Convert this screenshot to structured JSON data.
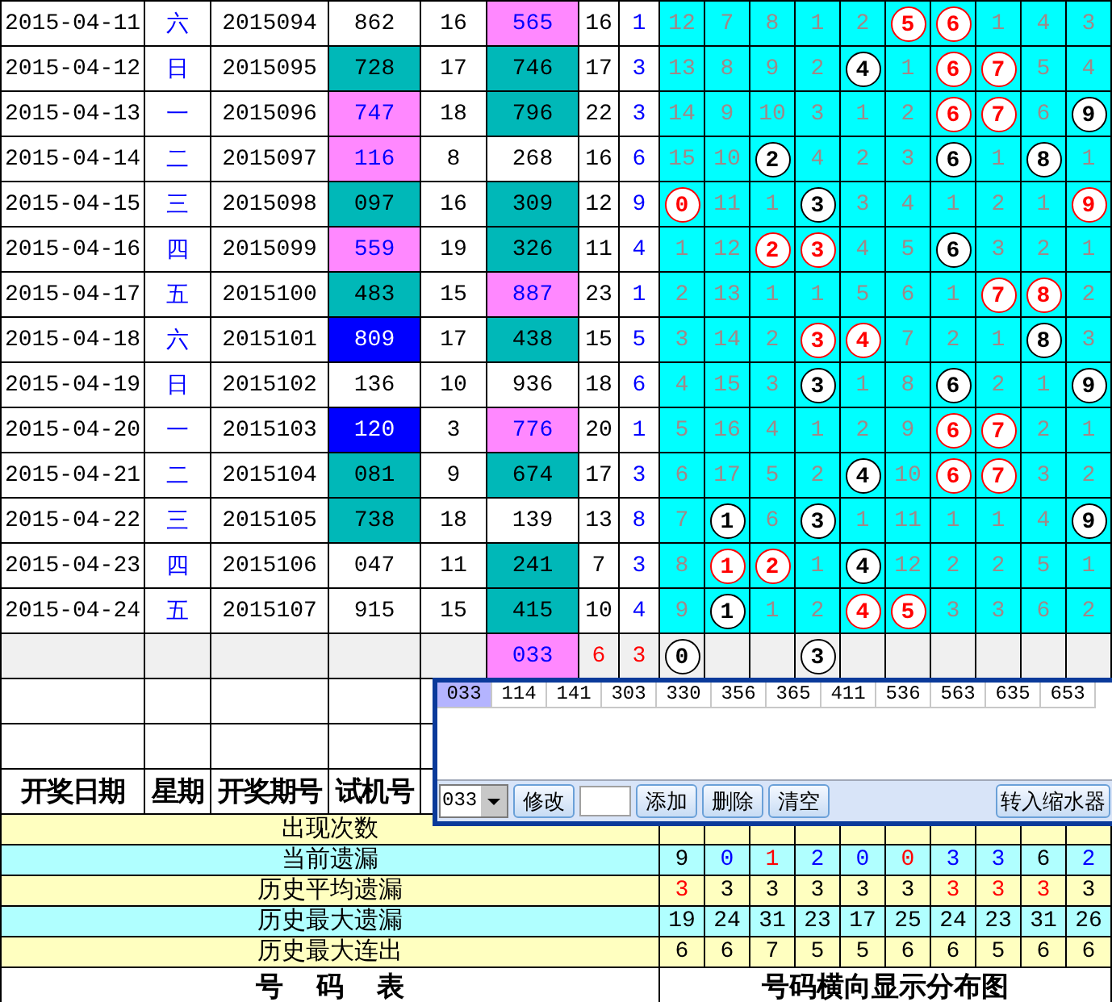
{
  "draws": [
    {
      "kind": "draw",
      "date": "2015-04-11",
      "weekday": "六",
      "period": "2015094",
      "trial": {
        "text": "862",
        "color": "#ffffff"
      },
      "trial_sum": "16",
      "number": {
        "text": "565",
        "color": "#ff88ff"
      },
      "number_sum": "16",
      "span": "1",
      "distribution": [
        {
          "kind": "miss",
          "text": "12"
        },
        {
          "kind": "miss",
          "text": "7"
        },
        {
          "kind": "miss",
          "text": "8"
        },
        {
          "kind": "miss",
          "text": "1"
        },
        {
          "kind": "miss",
          "text": "2"
        },
        {
          "kind": "ball",
          "text": "5",
          "color": "#ff0000"
        },
        {
          "kind": "ball",
          "text": "6",
          "color": "#ff0000"
        },
        {
          "kind": "miss",
          "text": "1"
        },
        {
          "kind": "miss",
          "text": "4"
        },
        {
          "kind": "miss",
          "text": "3"
        }
      ]
    },
    {
      "kind": "draw",
      "date": "2015-04-12",
      "weekday": "日",
      "period": "2015095",
      "trial": {
        "text": "728",
        "color": "#00b8b8"
      },
      "trial_sum": "17",
      "number": {
        "text": "746",
        "color": "#00b8b8"
      },
      "number_sum": "17",
      "span": "3",
      "distribution": [
        {
          "kind": "miss",
          "text": "13"
        },
        {
          "kind": "miss",
          "text": "8"
        },
        {
          "kind": "miss",
          "text": "9"
        },
        {
          "kind": "miss",
          "text": "2"
        },
        {
          "kind": "ball",
          "text": "4",
          "color": "#000000"
        },
        {
          "kind": "miss",
          "text": "1"
        },
        {
          "kind": "ball",
          "text": "6",
          "color": "#ff0000"
        },
        {
          "kind": "ball",
          "text": "7",
          "color": "#ff0000"
        },
        {
          "kind": "miss",
          "text": "5"
        },
        {
          "kind": "miss",
          "text": "4"
        }
      ]
    },
    {
      "kind": "draw",
      "date": "2015-04-13",
      "weekday": "一",
      "period": "2015096",
      "trial": {
        "text": "747",
        "color": "#ff88ff"
      },
      "trial_sum": "18",
      "number": {
        "text": "796",
        "color": "#00b8b8"
      },
      "number_sum": "22",
      "span": "3",
      "distribution": [
        {
          "kind": "miss",
          "text": "14"
        },
        {
          "kind": "miss",
          "text": "9"
        },
        {
          "kind": "miss",
          "text": "10"
        },
        {
          "kind": "miss",
          "text": "3"
        },
        {
          "kind": "miss",
          "text": "1"
        },
        {
          "kind": "miss",
          "text": "2"
        },
        {
          "kind": "ball",
          "text": "6",
          "color": "#ff0000"
        },
        {
          "kind": "ball",
          "text": "7",
          "color": "#ff0000"
        },
        {
          "kind": "miss",
          "text": "6"
        },
        {
          "kind": "ball",
          "text": "9",
          "color": "#000000"
        }
      ]
    },
    {
      "kind": "draw",
      "date": "2015-04-14",
      "weekday": "二",
      "period": "2015097",
      "trial": {
        "text": "116",
        "color": "#ff88ff"
      },
      "trial_sum": "8",
      "number": {
        "text": "268",
        "color": "#ffffff"
      },
      "number_sum": "16",
      "span": "6",
      "distribution": [
        {
          "kind": "miss",
          "text": "15"
        },
        {
          "kind": "miss",
          "text": "10"
        },
        {
          "kind": "ball",
          "text": "2",
          "color": "#000000"
        },
        {
          "kind": "miss",
          "text": "4"
        },
        {
          "kind": "miss",
          "text": "2"
        },
        {
          "kind": "miss",
          "text": "3"
        },
        {
          "kind": "ball",
          "text": "6",
          "color": "#000000"
        },
        {
          "kind": "miss",
          "text": "1"
        },
        {
          "kind": "ball",
          "text": "8",
          "color": "#000000"
        },
        {
          "kind": "miss",
          "text": "1"
        }
      ]
    },
    {
      "kind": "draw",
      "date": "2015-04-15",
      "weekday": "三",
      "period": "2015098",
      "trial": {
        "text": "097",
        "color": "#00b8b8"
      },
      "trial_sum": "16",
      "number": {
        "text": "309",
        "color": "#00b8b8"
      },
      "number_sum": "12",
      "span": "9",
      "distribution": [
        {
          "kind": "ball",
          "text": "0",
          "color": "#ff0000"
        },
        {
          "kind": "miss",
          "text": "11"
        },
        {
          "kind": "miss",
          "text": "1"
        },
        {
          "kind": "ball",
          "text": "3",
          "color": "#000000"
        },
        {
          "kind": "miss",
          "text": "3"
        },
        {
          "kind": "miss",
          "text": "4"
        },
        {
          "kind": "miss",
          "text": "1"
        },
        {
          "kind": "miss",
          "text": "2"
        },
        {
          "kind": "miss",
          "text": "1"
        },
        {
          "kind": "ball",
          "text": "9",
          "color": "#ff0000"
        }
      ]
    },
    {
      "kind": "draw",
      "date": "2015-04-16",
      "weekday": "四",
      "period": "2015099",
      "trial": {
        "text": "559",
        "color": "#ff88ff"
      },
      "trial_sum": "19",
      "number": {
        "text": "326",
        "color": "#00b8b8"
      },
      "number_sum": "11",
      "span": "4",
      "distribution": [
        {
          "kind": "miss",
          "text": "1"
        },
        {
          "kind": "miss",
          "text": "12"
        },
        {
          "kind": "ball",
          "text": "2",
          "color": "#ff0000"
        },
        {
          "kind": "ball",
          "text": "3",
          "color": "#ff0000"
        },
        {
          "kind": "miss",
          "text": "4"
        },
        {
          "kind": "miss",
          "text": "5"
        },
        {
          "kind": "ball",
          "text": "6",
          "color": "#000000"
        },
        {
          "kind": "miss",
          "text": "3"
        },
        {
          "kind": "miss",
          "text": "2"
        },
        {
          "kind": "miss",
          "text": "1"
        }
      ]
    },
    {
      "kind": "draw",
      "date": "2015-04-17",
      "weekday": "五",
      "period": "2015100",
      "trial": {
        "text": "483",
        "color": "#00b8b8"
      },
      "trial_sum": "15",
      "number": {
        "text": "887",
        "color": "#ff88ff"
      },
      "number_sum": "23",
      "span": "1",
      "distribution": [
        {
          "kind": "miss",
          "text": "2"
        },
        {
          "kind": "miss",
          "text": "13"
        },
        {
          "kind": "miss",
          "text": "1"
        },
        {
          "kind": "miss",
          "text": "1"
        },
        {
          "kind": "miss",
          "text": "5"
        },
        {
          "kind": "miss",
          "text": "6"
        },
        {
          "kind": "miss",
          "text": "1"
        },
        {
          "kind": "ball",
          "text": "7",
          "color": "#ff0000"
        },
        {
          "kind": "ball",
          "text": "8",
          "color": "#ff0000"
        },
        {
          "kind": "miss",
          "text": "2"
        }
      ]
    },
    {
      "kind": "draw",
      "date": "2015-04-18",
      "weekday": "六",
      "period": "2015101",
      "trial": {
        "text": "809",
        "color": "#0000ff"
      },
      "trial_sum": "17",
      "number": {
        "text": "438",
        "color": "#00b8b8"
      },
      "number_sum": "15",
      "span": "5",
      "distribution": [
        {
          "kind": "miss",
          "text": "3"
        },
        {
          "kind": "miss",
          "text": "14"
        },
        {
          "kind": "miss",
          "text": "2"
        },
        {
          "kind": "ball",
          "text": "3",
          "color": "#ff0000"
        },
        {
          "kind": "ball",
          "text": "4",
          "color": "#ff0000"
        },
        {
          "kind": "miss",
          "text": "7"
        },
        {
          "kind": "miss",
          "text": "2"
        },
        {
          "kind": "miss",
          "text": "1"
        },
        {
          "kind": "ball",
          "text": "8",
          "color": "#000000"
        },
        {
          "kind": "miss",
          "text": "3"
        }
      ]
    },
    {
      "kind": "draw",
      "date": "2015-04-19",
      "weekday": "日",
      "period": "2015102",
      "trial": {
        "text": "136",
        "color": "#ffffff"
      },
      "trial_sum": "10",
      "number": {
        "text": "936",
        "color": "#ffffff"
      },
      "number_sum": "18",
      "span": "6",
      "distribution": [
        {
          "kind": "miss",
          "text": "4"
        },
        {
          "kind": "miss",
          "text": "15"
        },
        {
          "kind": "miss",
          "text": "3"
        },
        {
          "kind": "ball",
          "text": "3",
          "color": "#000000"
        },
        {
          "kind": "miss",
          "text": "1"
        },
        {
          "kind": "miss",
          "text": "8"
        },
        {
          "kind": "ball",
          "text": "6",
          "color": "#000000"
        },
        {
          "kind": "miss",
          "text": "2"
        },
        {
          "kind": "miss",
          "text": "1"
        },
        {
          "kind": "ball",
          "text": "9",
          "color": "#000000"
        }
      ]
    },
    {
      "kind": "draw",
      "date": "2015-04-20",
      "weekday": "一",
      "period": "2015103",
      "trial": {
        "text": "120",
        "color": "#0000ff"
      },
      "trial_sum": "3",
      "number": {
        "text": "776",
        "color": "#ff88ff"
      },
      "number_sum": "20",
      "span": "1",
      "distribution": [
        {
          "kind": "miss",
          "text": "5"
        },
        {
          "kind": "miss",
          "text": "16"
        },
        {
          "kind": "miss",
          "text": "4"
        },
        {
          "kind": "miss",
          "text": "1"
        },
        {
          "kind": "miss",
          "text": "2"
        },
        {
          "kind": "miss",
          "text": "9"
        },
        {
          "kind": "ball",
          "text": "6",
          "color": "#ff0000"
        },
        {
          "kind": "ball",
          "text": "7",
          "color": "#ff0000"
        },
        {
          "kind": "miss",
          "text": "2"
        },
        {
          "kind": "miss",
          "text": "1"
        }
      ]
    },
    {
      "kind": "draw",
      "date": "2015-04-21",
      "weekday": "二",
      "period": "2015104",
      "trial": {
        "text": "081",
        "color": "#00b8b8"
      },
      "trial_sum": "9",
      "number": {
        "text": "674",
        "color": "#00b8b8"
      },
      "number_sum": "17",
      "span": "3",
      "distribution": [
        {
          "kind": "miss",
          "text": "6"
        },
        {
          "kind": "miss",
          "text": "17"
        },
        {
          "kind": "miss",
          "text": "5"
        },
        {
          "kind": "miss",
          "text": "2"
        },
        {
          "kind": "ball",
          "text": "4",
          "color": "#000000"
        },
        {
          "kind": "miss",
          "text": "10"
        },
        {
          "kind": "ball",
          "text": "6",
          "color": "#ff0000"
        },
        {
          "kind": "ball",
          "text": "7",
          "color": "#ff0000"
        },
        {
          "kind": "miss",
          "text": "3"
        },
        {
          "kind": "miss",
          "text": "2"
        }
      ]
    },
    {
      "kind": "draw",
      "date": "2015-04-22",
      "weekday": "三",
      "period": "2015105",
      "trial": {
        "text": "738",
        "color": "#00b8b8"
      },
      "trial_sum": "18",
      "number": {
        "text": "139",
        "color": "#ffffff"
      },
      "number_sum": "13",
      "span": "8",
      "distribution": [
        {
          "kind": "miss",
          "text": "7"
        },
        {
          "kind": "ball",
          "text": "1",
          "color": "#000000"
        },
        {
          "kind": "miss",
          "text": "6"
        },
        {
          "kind": "ball",
          "text": "3",
          "color": "#000000"
        },
        {
          "kind": "miss",
          "text": "1"
        },
        {
          "kind": "miss",
          "text": "11"
        },
        {
          "kind": "miss",
          "text": "1"
        },
        {
          "kind": "miss",
          "text": "1"
        },
        {
          "kind": "miss",
          "text": "4"
        },
        {
          "kind": "ball",
          "text": "9",
          "color": "#000000"
        }
      ]
    },
    {
      "kind": "draw",
      "date": "2015-04-23",
      "weekday": "四",
      "period": "2015106",
      "trial": {
        "text": "047",
        "color": "#ffffff"
      },
      "trial_sum": "11",
      "number": {
        "text": "241",
        "color": "#00b8b8"
      },
      "number_sum": "7",
      "span": "3",
      "distribution": [
        {
          "kind": "miss",
          "text": "8"
        },
        {
          "kind": "ball",
          "text": "1",
          "color": "#ff0000"
        },
        {
          "kind": "ball",
          "text": "2",
          "color": "#ff0000"
        },
        {
          "kind": "miss",
          "text": "1"
        },
        {
          "kind": "ball",
          "text": "4",
          "color": "#000000"
        },
        {
          "kind": "miss",
          "text": "12"
        },
        {
          "kind": "miss",
          "text": "2"
        },
        {
          "kind": "miss",
          "text": "2"
        },
        {
          "kind": "miss",
          "text": "5"
        },
        {
          "kind": "miss",
          "text": "1"
        }
      ]
    },
    {
      "kind": "draw",
      "date": "2015-04-24",
      "weekday": "五",
      "period": "2015107",
      "trial": {
        "text": "915",
        "color": "#ffffff"
      },
      "trial_sum": "15",
      "number": {
        "text": "415",
        "color": "#00b8b8"
      },
      "number_sum": "10",
      "span": "4",
      "distribution": [
        {
          "kind": "miss",
          "text": "9"
        },
        {
          "kind": "ball",
          "text": "1",
          "color": "#000000"
        },
        {
          "kind": "miss",
          "text": "1"
        },
        {
          "kind": "miss",
          "text": "2"
        },
        {
          "kind": "ball",
          "text": "4",
          "color": "#ff0000"
        },
        {
          "kind": "ball",
          "text": "5",
          "color": "#ff0000"
        },
        {
          "kind": "miss",
          "text": "3"
        },
        {
          "kind": "miss",
          "text": "3"
        },
        {
          "kind": "miss",
          "text": "6"
        },
        {
          "kind": "miss",
          "text": "2"
        }
      ]
    },
    {
      "kind": "forecast",
      "number": {
        "text": "033",
        "color": "#ff88ff"
      },
      "number_sum": "6",
      "span": "3",
      "distribution": [
        {
          "kind": "ball",
          "text": "0",
          "color": "#000000"
        },
        {
          "kind": "empty"
        },
        {
          "kind": "empty"
        },
        {
          "kind": "ball",
          "text": "3",
          "color": "#000000"
        },
        {
          "kind": "empty"
        },
        {
          "kind": "empty"
        },
        {
          "kind": "empty"
        },
        {
          "kind": "empty"
        },
        {
          "kind": "empty"
        },
        {
          "kind": "empty"
        }
      ]
    }
  ],
  "header": [
    "开奖日期",
    "星期",
    "开奖期号",
    "试机号"
  ],
  "stats": [
    {
      "label": "出现次数"
    },
    {
      "label": "当前遗漏",
      "values": [
        {
          "text": "9",
          "color": "#000000"
        },
        {
          "text": "0",
          "color": "#0000ff"
        },
        {
          "text": "1",
          "color": "#ff0000"
        },
        {
          "text": "2",
          "color": "#0000ff"
        },
        {
          "text": "0",
          "color": "#0000ff"
        },
        {
          "text": "0",
          "color": "#ff0000"
        },
        {
          "text": "3",
          "color": "#0000ff"
        },
        {
          "text": "3",
          "color": "#0000ff"
        },
        {
          "text": "6",
          "color": "#000000"
        },
        {
          "text": "2",
          "color": "#0000ff"
        }
      ]
    },
    {
      "label": "历史平均遗漏",
      "values": [
        {
          "text": "3",
          "color": "#ff0000"
        },
        {
          "text": "3",
          "color": "#000000"
        },
        {
          "text": "3",
          "color": "#000000"
        },
        {
          "text": "3",
          "color": "#000000"
        },
        {
          "text": "3",
          "color": "#000000"
        },
        {
          "text": "3",
          "color": "#000000"
        },
        {
          "text": "3",
          "color": "#ff0000"
        },
        {
          "text": "3",
          "color": "#ff0000"
        },
        {
          "text": "3",
          "color": "#ff0000"
        },
        {
          "text": "3",
          "color": "#000000"
        }
      ]
    },
    {
      "label": "历史最大遗漏",
      "values": [
        {
          "text": "19",
          "color": "#000000"
        },
        {
          "text": "24",
          "color": "#000000"
        },
        {
          "text": "31",
          "color": "#000000"
        },
        {
          "text": "23",
          "color": "#000000"
        },
        {
          "text": "17",
          "color": "#000000"
        },
        {
          "text": "25",
          "color": "#000000"
        },
        {
          "text": "24",
          "color": "#000000"
        },
        {
          "text": "23",
          "color": "#000000"
        },
        {
          "text": "31",
          "color": "#000000"
        },
        {
          "text": "26",
          "color": "#000000"
        }
      ]
    },
    {
      "label": "历史最大连出",
      "values": [
        {
          "text": "6",
          "color": "#000000"
        },
        {
          "text": "6",
          "color": "#000000"
        },
        {
          "text": "7",
          "color": "#000000"
        },
        {
          "text": "5",
          "color": "#000000"
        },
        {
          "text": "5",
          "color": "#000000"
        },
        {
          "text": "6",
          "color": "#000000"
        },
        {
          "text": "6",
          "color": "#000000"
        },
        {
          "text": "5",
          "color": "#000000"
        },
        {
          "text": "6",
          "color": "#000000"
        },
        {
          "text": "6",
          "color": "#000000"
        }
      ]
    }
  ],
  "footer": {
    "left": "号  码  表",
    "right": "号码横向显示分布图"
  },
  "popup": {
    "items": [
      {
        "text": "033",
        "selected": true
      },
      {
        "text": "114",
        "selected": false
      },
      {
        "text": "141",
        "selected": false
      },
      {
        "text": "303",
        "selected": false
      },
      {
        "text": "330",
        "selected": false
      },
      {
        "text": "356",
        "selected": false
      },
      {
        "text": "365",
        "selected": false
      },
      {
        "text": "411",
        "selected": false
      },
      {
        "text": "536",
        "selected": false
      },
      {
        "text": "563",
        "selected": false
      },
      {
        "text": "635",
        "selected": false
      },
      {
        "text": "653",
        "selected": false
      }
    ],
    "combo": "033",
    "buttons": [
      "修改",
      "添加",
      "删除",
      "清空",
      "转入缩水器"
    ]
  }
}
